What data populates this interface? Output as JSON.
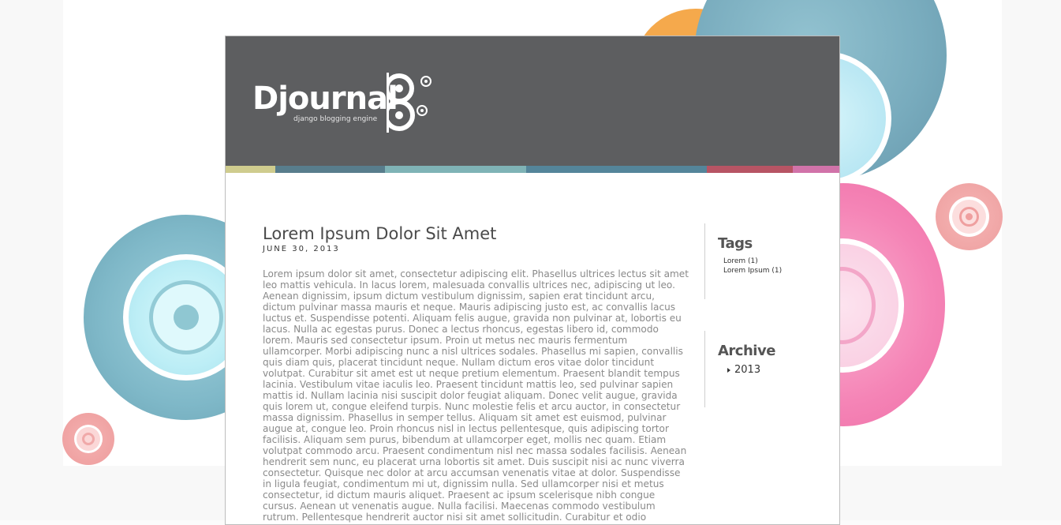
{
  "site": {
    "logo_text": "Djournal",
    "tagline": "django blogging engine"
  },
  "color_strip": [
    "#cfcc8e",
    "#587d8c",
    "#7fb3b6",
    "#54859a",
    "#b75464",
    "#d173a9"
  ],
  "post": {
    "title": "Lorem Ipsum Dolor Sit Amet",
    "date": "JUNE 30, 2013",
    "body": "Lorem ipsum dolor sit amet, consectetur adipiscing elit. Phasellus ultrices lectus sit amet leo mattis vehicula. In lacus lorem, malesuada convallis ultrices nec, adipiscing ut leo. Aenean dignissim, ipsum dictum vestibulum dignissim, sapien erat tincidunt arcu, dictum pulvinar massa mauris et neque. Mauris adipiscing justo est, ac convallis lacus luctus et. Suspendisse potenti. Aliquam felis augue, gravida non pulvinar at, lobortis eu lacus. Nulla ac egestas purus. Donec a lectus rhoncus, egestas libero id, commodo lorem. Mauris sed consectetur ipsum. Proin ut metus nec mauris fermentum ullamcorper. Morbi adipiscing nunc a nisl ultrices sodales. Phasellus mi sapien, convallis quis diam quis, placerat tincidunt neque. Nullam dictum eros vitae dolor tincidunt volutpat. Curabitur sit amet est ut neque pretium elementum. Praesent blandit tempus lacinia. Vestibulum vitae iaculis leo. Praesent tincidunt mattis leo, sed pulvinar sapien mattis id. Nullam lacinia nisi suscipit dolor feugiat aliquam. Donec velit augue, gravida quis lorem ut, congue eleifend turpis. Nunc molestie felis et arcu auctor, in consectetur massa dignissim. Phasellus in semper tellus. Aliquam sit amet est euismod, pulvinar augue at, congue leo. Proin rhoncus nisl in lectus pellentesque, quis adipiscing tortor facilisis. Aliquam sem purus, bibendum at ullamcorper eget, mollis nec quam. Etiam volutpat commodo arcu. Praesent condimentum nisl nec massa sodales facilisis. Aenean hendrerit sem nunc, eu placerat urna lobortis sit amet. Duis suscipit nisi ac nunc viverra consectetur. Quisque nec dolor at arcu accumsan venenatis vitae at dolor. Suspendisse in ligula feugiat, condimentum mi ut, dignissim nulla. Sed ullamcorper nisi et metus consectetur, id dictum mauris aliquet. Praesent ac ipsum scelerisque nibh congue cursus. Aenean ut venenatis augue. Nulla facilisi. Maecenas commodo vestibulum rutrum. Pellentesque hendrerit auctor nisi sit amet sollicitudin. Curabitur et odio"
  },
  "sidebar": {
    "tags_title": "Tags",
    "tags": [
      "Lorem (1)",
      "Lorem Ipsum (1)"
    ],
    "archive_title": "Archive",
    "archive": [
      "2013"
    ]
  }
}
